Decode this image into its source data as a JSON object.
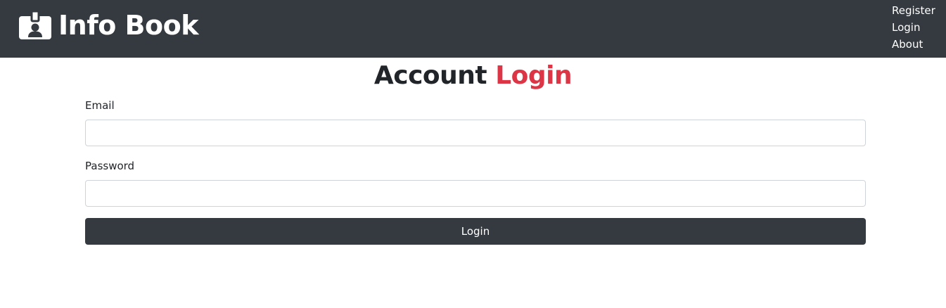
{
  "navbar": {
    "brand": {
      "icon": "id-badge-icon",
      "text": "Info Book"
    },
    "links": [
      "Register",
      "Login",
      "About"
    ]
  },
  "page": {
    "title_part1": "Account",
    "title_part2": "Login"
  },
  "form": {
    "email_label": "Email",
    "email_value": "",
    "password_label": "Password",
    "password_value": "",
    "submit_label": "Login"
  },
  "colors": {
    "navbar_bg": "#343a40",
    "accent": "#dc3545",
    "text": "#212529",
    "input_border": "#ced4da",
    "button_bg": "#343a40"
  }
}
